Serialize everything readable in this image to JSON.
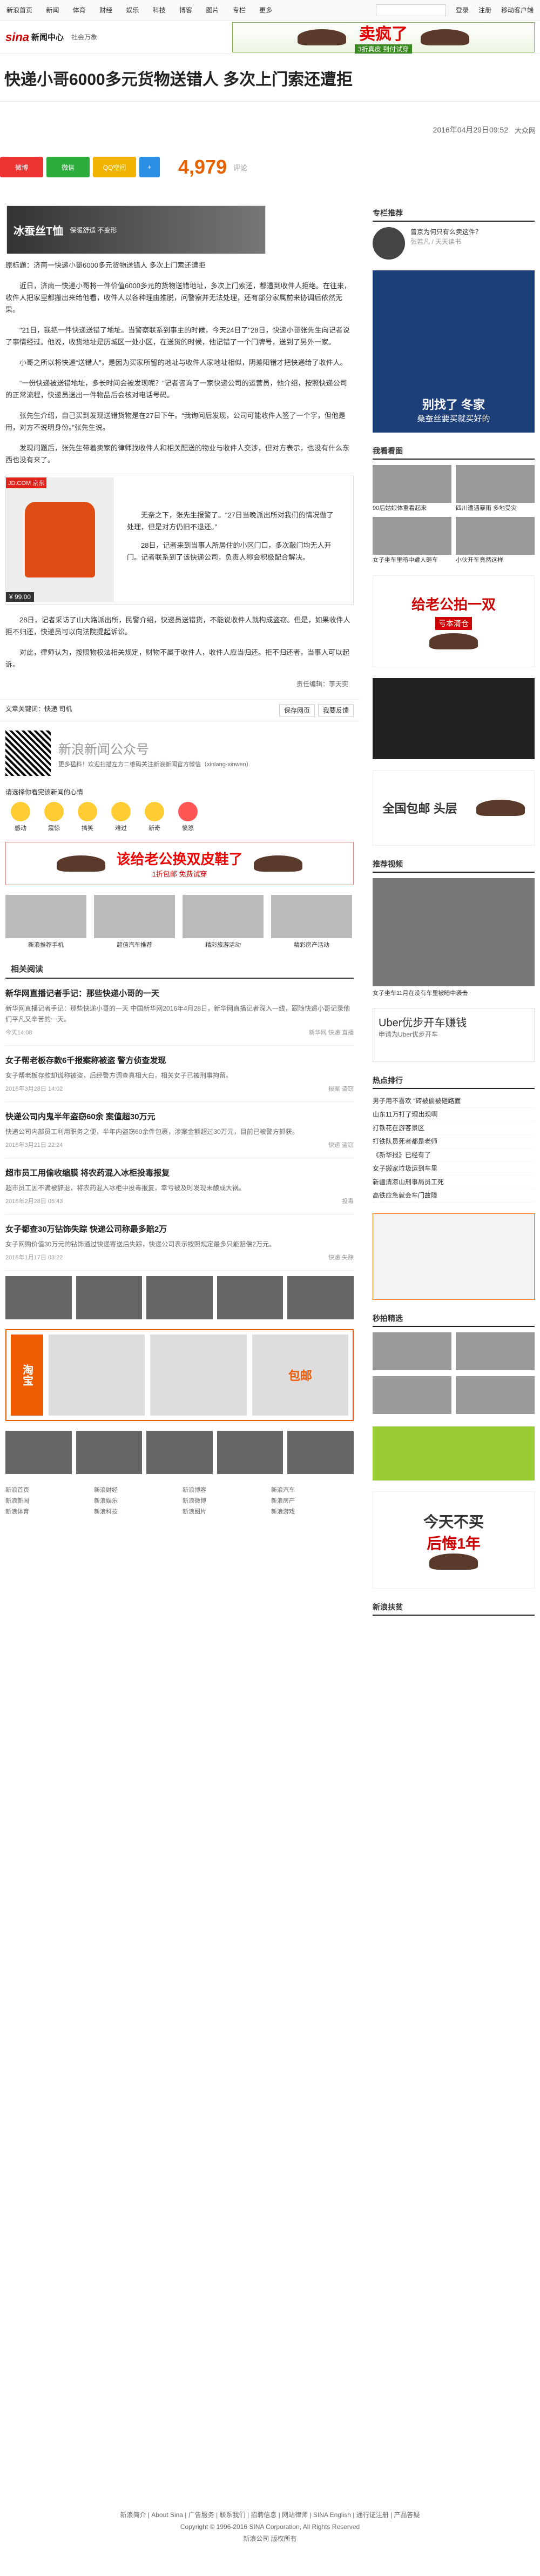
{
  "topbar": {
    "nav": [
      "新浪首页",
      "新闻",
      "体育",
      "财经",
      "娱乐",
      "科技",
      "博客",
      "图片",
      "专栏",
      "更多"
    ],
    "right": [
      "登录",
      "注册",
      "移动客户端"
    ]
  },
  "logo": {
    "brand": "sina",
    "name": "新闻中心",
    "channel": "社会万象"
  },
  "header_ad": {
    "text": "卖疯了",
    "sub": "3折真皮 到付试穿"
  },
  "article": {
    "title": "快递小哥6000多元货物送错人 多次上门索还遭拒",
    "date": "2016年04月29日09:52",
    "source": "大众网",
    "count": "4,979",
    "count_label": "评论",
    "share": [
      "微博",
      "微信",
      "QQ空间",
      "+"
    ],
    "ad_text": "冰蚕丝T恤",
    "ad_sub": "保暖舒适 不变形",
    "paragraphs": [
      "原标题：济南一快递小哥6000多元货物送错人 多次上门索还遭拒",
      "近日，济南一快递小哥将一件价值6000多元的货物送错地址，多次上门索还，都遭到收件人拒绝。在往来，收件人把家里都搬出来给他看，收件人以各种理由推脱，问警察并无法处理，还有部分家属前来协调后依然无果。",
      "\"21日，我把一件快递送错了地址。当警察联系到事主的时候，今天24日了\"28日，快递小哥张先生向记者说了事情经过。他说，收货地址是历城区一处小区，在送货的时候，他记错了一个门牌号，送到了另外一家。",
      "小哥之所以将快递“送错人”，是因为买家所留的地址与收件人家地址相似，阴差阳错才把快递给了收件人。",
      "“一份快递被送错地址，多长时间会被发现呢？”记者咨询了一家快递公司的运营员，他介绍，按照快递公司的正常流程，快递员送出一件物品后会核对电话号码。",
      "张先生介绍，自己买到发现送错货物是在27日下午。“我询问后发现，公司可能收件人签了一个字，但他是用，对方不说明身份。”张先生说。",
      "发现问题后，张先生带着卖家的律师找收件人和相关配送的物业与收件人交涉，但对方表示，也没有什么东西也没有来了。",
      "无奈之下，张先生报警了。“27日当晚派出所对我们的情况做了处理，但是对方仍旧不退还。”",
      "28日，记者来到当事人所居住的小区门口，多次敲门均无人开门。记者联系到了该快递公司，负责人称会积极配合解决。",
      "28日，记者采访了山大路派出所，民警介绍，快递员送错货，不能说收件人就构成盗窃。但是，如果收件人拒不归还，快递员可以向法院提起诉讼。",
      "对此，律师认为，按照物权法相关规定，财物不属于收件人，收件人应当归还。拒不归还者，当事人可以起诉。"
    ],
    "product": {
      "price": "¥ 99.00",
      "tag": "JD.COM 京东"
    },
    "editor": "责任编辑：李天奕",
    "tags": "文章关键词：快递 司机",
    "tag_buttons": [
      "保存网页",
      "我要反馈"
    ],
    "wechat": {
      "name": "新浪新闻公众号",
      "desc": "更多猛料！欢迎扫描左方二维码关注新浪新闻官方微信（xinlang-xinwen）"
    },
    "mood_title": "请选择你看完该新闻的心情",
    "moods": [
      "感动",
      "震惊",
      "搞笑",
      "难过",
      "新奇",
      "愤怒"
    ],
    "wide_ad": "该给老公换双皮鞋了",
    "wide_ad_sub": "1折包邮 免费试穿",
    "thumbs": [
      "新浪推荐手机",
      "超值汽车推荐",
      "精彩旅游活动",
      "精彩房产活动"
    ]
  },
  "related": {
    "title": "相关阅读",
    "items": [
      {
        "title": "新华网直播记者手记：那些快递小哥的一天",
        "desc": "新华网直播记者手记：那些快递小哥的一天 中国新华网2016年4月28日，新华网直播记者深入一线，跟随快递小哥记录他们平凡又辛苦的一天。",
        "date": "今天14:08",
        "tag": "新华网 快递 直播"
      },
      {
        "title": "女子帮老板存款6千报案称被盗 警方侦查发现",
        "desc": "女子帮老板存款却谎称被盗，后经警方调查真相大白，相关女子已被刑事拘留。",
        "date": "2016年3月28日 14:02",
        "tag": "报案 盗窃"
      },
      {
        "title": "快递公司内鬼半年盗窃60余 案值超30万元",
        "desc": "快递公司内部员工利用职务之便，半年内盗窃60余件包裹，涉案金额超过30万元，目前已被警方抓获。",
        "date": "2016年3月21日 22:24",
        "tag": "快递 盗窃"
      },
      {
        "title": "超市员工用偷收缩膜 将农药混入冰柜投毒报复",
        "desc": "超市员工因不满被辞退，将农药混入冰柜中投毒报复，幸亏被及时发现未酿成大祸。",
        "date": "2016年2月28日 05:43",
        "tag": "投毒"
      },
      {
        "title": "女子都查30万钻饰失踪 快递公司称最多赔2万",
        "desc": "女子网购价值30万元的钻饰通过快递寄送后失踪，快递公司表示按照规定最多只能赔偿2万元。",
        "date": "2016年1月17日 03:22",
        "tag": "快递 失踪"
      }
    ]
  },
  "taobao": {
    "label": "淘宝",
    "sub": "包邮"
  },
  "footer_links": [
    "新浪首页",
    "新浪新闻",
    "新浪体育",
    "新浪财经",
    "新浪娱乐",
    "新浪科技",
    "新浪博客",
    "新浪微博",
    "新浪图片",
    "新浪汽车",
    "新浪房产",
    "新浪游戏"
  ],
  "bottom": {
    "links": "新浪简介 | About Sina | 广告服务 | 联系我们 | 招聘信息 | 网站律师 | SINA English | 通行证注册 | 产品答疑",
    "copyright": "Copyright © 1996-2016 SINA Corporation, All Rights Reserved",
    "company": "新浪公司 版权所有"
  },
  "side": {
    "recommend_title": "专栏推荐",
    "recommend_text": "曾京为何只有么卖这件？",
    "recommend_author": "张若凡 / 天天读书",
    "ad1": "别找了 冬家",
    "ad1_sub": "桑蚕丝要买就买好的",
    "pics_title": "我看看图",
    "pics": [
      "90后姑娘体重看起来",
      "四川遭遇暴雨 多地受灾",
      "女子坐车里暗中遭人砸车",
      "小伙开车竟然这样"
    ],
    "ad2": "给老公拍一双",
    "ad2_sub": "亏本清仓",
    "ad3": "全国包邮 头层",
    "video_title": "推荐视频",
    "video_caption": "女子坐车11月在没有车里被暗中袭击",
    "uber": "Uber优步开车赚钱",
    "uber_sub": "申请为Uber优步开车",
    "hot_title": "热点排行",
    "hot": [
      "男子用不喜欢 “砖被偷被砸路面",
      "山东11万打了理出现啊",
      "打铁花在游客景区",
      "打铁队员死者都是老师",
      "《新华报》已经有了",
      "女子搬家垃圾运到车里",
      "新疆清凉山刑事局员工死",
      "高铁应急就会车门故障"
    ],
    "spot_title": "秒拍精选",
    "ad4": "今天不买",
    "ad4_sub": "后悔1年",
    "tb_title": "新浪扶贫"
  }
}
